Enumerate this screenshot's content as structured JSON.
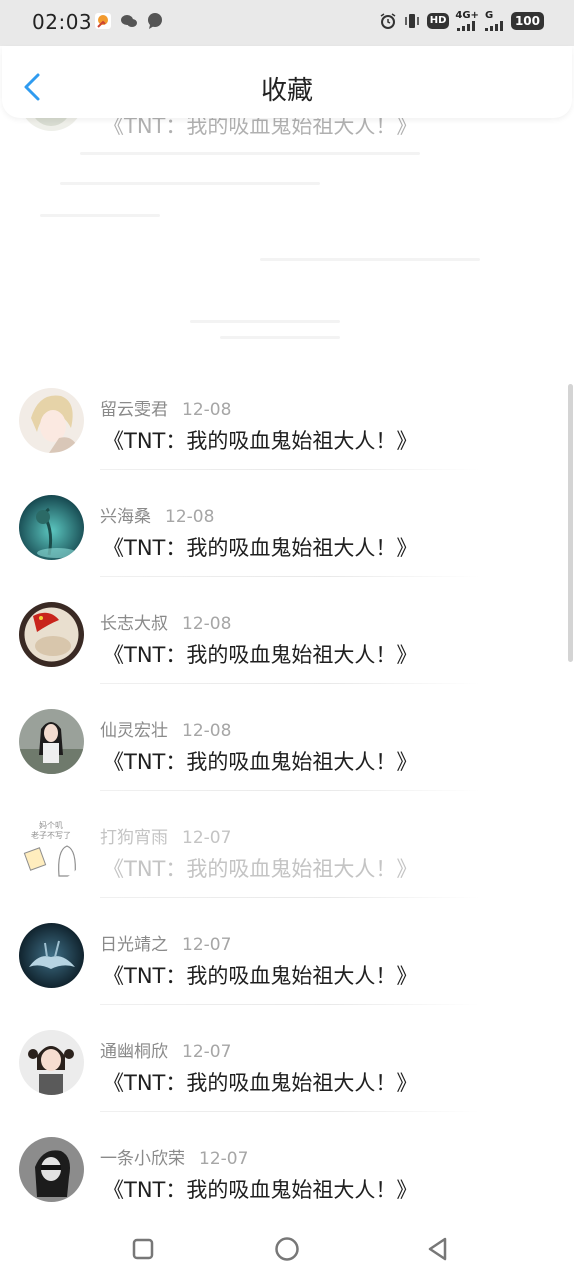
{
  "status_bar": {
    "time": "02:03",
    "hd_label": "HD",
    "net_4g": "4G+",
    "net_g": "G",
    "battery": "100"
  },
  "header": {
    "title": "收藏",
    "back_icon": "chevron-left-icon"
  },
  "partial_top_row": {
    "book_title": "《TNT：我的吸血鬼始祖大人！》"
  },
  "items": [
    {
      "user": "留云雯君",
      "date": "12-08",
      "book_title": "《TNT：我的吸血鬼始祖大人！》",
      "faded": false
    },
    {
      "user": "兴海桑",
      "date": "12-08",
      "book_title": "《TNT：我的吸血鬼始祖大人！》",
      "faded": false
    },
    {
      "user": "长志大叔",
      "date": "12-08",
      "book_title": "《TNT：我的吸血鬼始祖大人！》",
      "faded": false
    },
    {
      "user": "仙灵宏壮",
      "date": "12-08",
      "book_title": "《TNT：我的吸血鬼始祖大人！》",
      "faded": false
    },
    {
      "user": "打狗宵雨",
      "date": "12-07",
      "book_title": "《TNT：我的吸血鬼始祖大人！》",
      "faded": true,
      "avatar_text": [
        "妈个叽",
        "老子不写了"
      ]
    },
    {
      "user": "日光靖之",
      "date": "12-07",
      "book_title": "《TNT：我的吸血鬼始祖大人！》",
      "faded": false
    },
    {
      "user": "通幽桐欣",
      "date": "12-07",
      "book_title": "《TNT：我的吸血鬼始祖大人！》",
      "faded": false
    },
    {
      "user": "一条小欣荣",
      "date": "12-07",
      "book_title": "《TNT：我的吸血鬼始祖大人！》",
      "faded": false
    }
  ],
  "nav_bar": {
    "recent_icon": "square-icon",
    "home_icon": "circle-icon",
    "back_icon": "triangle-back-icon"
  },
  "colors": {
    "accent": "#2f9bf0",
    "text_primary": "#1f1f1f",
    "text_secondary": "#8a8a8a"
  }
}
